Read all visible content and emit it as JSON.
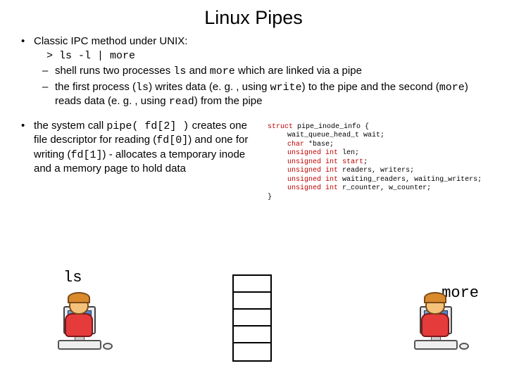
{
  "title": "Linux Pipes",
  "bullet1": {
    "lead": "Classic IPC method under UNIX:",
    "cmd_prefix": "> ",
    "cmd": "ls -l | more",
    "sub1_a": "shell runs two processes ",
    "sub1_ls": "ls",
    "sub1_b": " and ",
    "sub1_more": "more",
    "sub1_c": " which are linked via a pipe",
    "sub2_a": "the first process (",
    "sub2_ls": "ls",
    "sub2_b": ") writes data (e. g. , using ",
    "sub2_write": "write",
    "sub2_c": ") to the pipe and the second (",
    "sub2_more": "more",
    "sub2_d": ") reads data (e. g. , using ",
    "sub2_read": "read",
    "sub2_e": ") from the pipe"
  },
  "bullet2": {
    "a": "the system call ",
    "pipe": "pipe( fd[2] )",
    "b": " creates one file descriptor for reading (",
    "fd0": "fd[0]",
    "c": ") and one for writing (",
    "fd1": "fd[1]",
    "d": ") - allocates a temporary inode and a memory page to hold data"
  },
  "struct": {
    "l0a": "struct",
    "l0b": " pipe_inode_info {",
    "l1": "wait_queue_head_t wait;",
    "l2a": "char",
    "l2b": " *base;",
    "l3a": "unsigned",
    "l3b": "int",
    "l3c": " len;",
    "l4a": "unsigned",
    "l4b": "int",
    "l4c": "start",
    "l4d": ";",
    "l5a": "unsigned",
    "l5b": "int",
    "l5c": " readers, writers;",
    "l6a": "unsigned",
    "l6b": "int",
    "l6c": " waiting_readers, waiting_writers;",
    "l7a": "unsigned",
    "l7b": "int",
    "l7c": " r_counter, w_counter;",
    "l8": "}"
  },
  "labels": {
    "ls": "ls",
    "more": "more"
  },
  "colors": {
    "keyword": "#c00000"
  }
}
